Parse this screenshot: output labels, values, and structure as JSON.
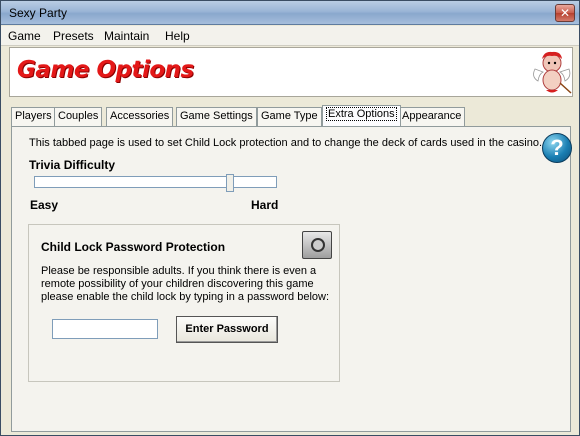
{
  "window": {
    "title": "Sexy Party",
    "close_label": "✕"
  },
  "menu": {
    "items": [
      "Game",
      "Presets",
      "Maintain",
      "Help"
    ]
  },
  "header": {
    "title": "Game Options"
  },
  "tabs": [
    "Players",
    "Couples",
    "Accessories",
    "Game Settings",
    "Game Type",
    "Extra Options",
    "Appearance"
  ],
  "active_tab": "Extra Options",
  "description": "This tabbed page is used to set Child Lock protection and to change the deck of cards used in the casino.",
  "help_icon": "?",
  "trivia": {
    "title": "Trivia Difficulty",
    "min_label": "Easy",
    "max_label": "Hard",
    "value_fraction": 0.82
  },
  "child_lock": {
    "title": "Child Lock Password Protection",
    "description": "Please be responsible adults. If you think there is even a remote possibility of your children discovering this game please enable the child lock by typing in a password below:",
    "password_value": "",
    "button_label": "Enter Password"
  }
}
